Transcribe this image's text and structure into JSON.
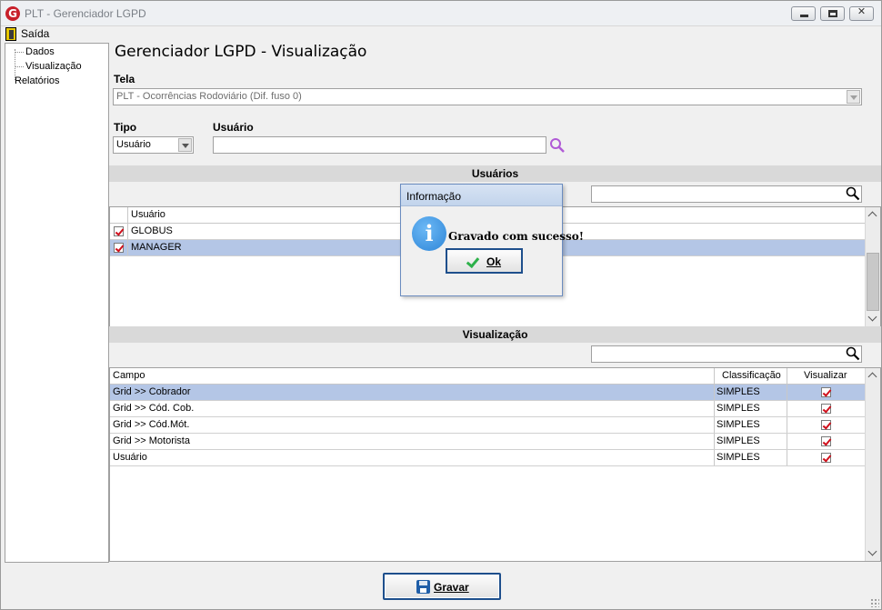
{
  "window": {
    "title": "PLT - Gerenciador LGPD"
  },
  "menu": {
    "saida": "Saída"
  },
  "tree": {
    "items": [
      "Dados",
      "Visualização",
      "Relatórios"
    ]
  },
  "page_title": "Gerenciador LGPD - Visualização",
  "tela": {
    "label": "Tela",
    "value": "PLT - Ocorrências Rodoviário (Dif. fuso 0)"
  },
  "tipo": {
    "label": "Tipo",
    "value": "Usuário"
  },
  "usuario": {
    "label": "Usuário",
    "value": ""
  },
  "usuarios_section": {
    "title": "Usuários",
    "filter": "",
    "column": "Usuário",
    "rows": [
      {
        "checked": true,
        "name": "GLOBUS",
        "selected": false
      },
      {
        "checked": true,
        "name": "MANAGER",
        "selected": true
      }
    ]
  },
  "visualizacao_section": {
    "title": "Visualização",
    "filter": "",
    "columns": [
      "Campo",
      "Classificação",
      "Visualizar"
    ],
    "rows": [
      {
        "campo": "Grid >> Cobrador",
        "classificacao": "SIMPLES",
        "visualizar": true,
        "selected": true
      },
      {
        "campo": "Grid >> Cód. Cob.",
        "classificacao": "SIMPLES",
        "visualizar": true,
        "selected": false
      },
      {
        "campo": "Grid >> Cód.Mót.",
        "classificacao": "SIMPLES",
        "visualizar": true,
        "selected": false
      },
      {
        "campo": "Grid >> Motorista",
        "classificacao": "SIMPLES",
        "visualizar": true,
        "selected": false
      },
      {
        "campo": "Usuário",
        "classificacao": "SIMPLES",
        "visualizar": true,
        "selected": false
      }
    ]
  },
  "buttons": {
    "gravar": "Gravar"
  },
  "dialog": {
    "title": "Informação",
    "message": "Gravado com sucesso!",
    "ok": "Ok"
  },
  "colors": {
    "selection": "#b4c6e6",
    "check": "#d0101c",
    "button_border": "#1e4f8c",
    "info_icon": "#2e86d8"
  }
}
